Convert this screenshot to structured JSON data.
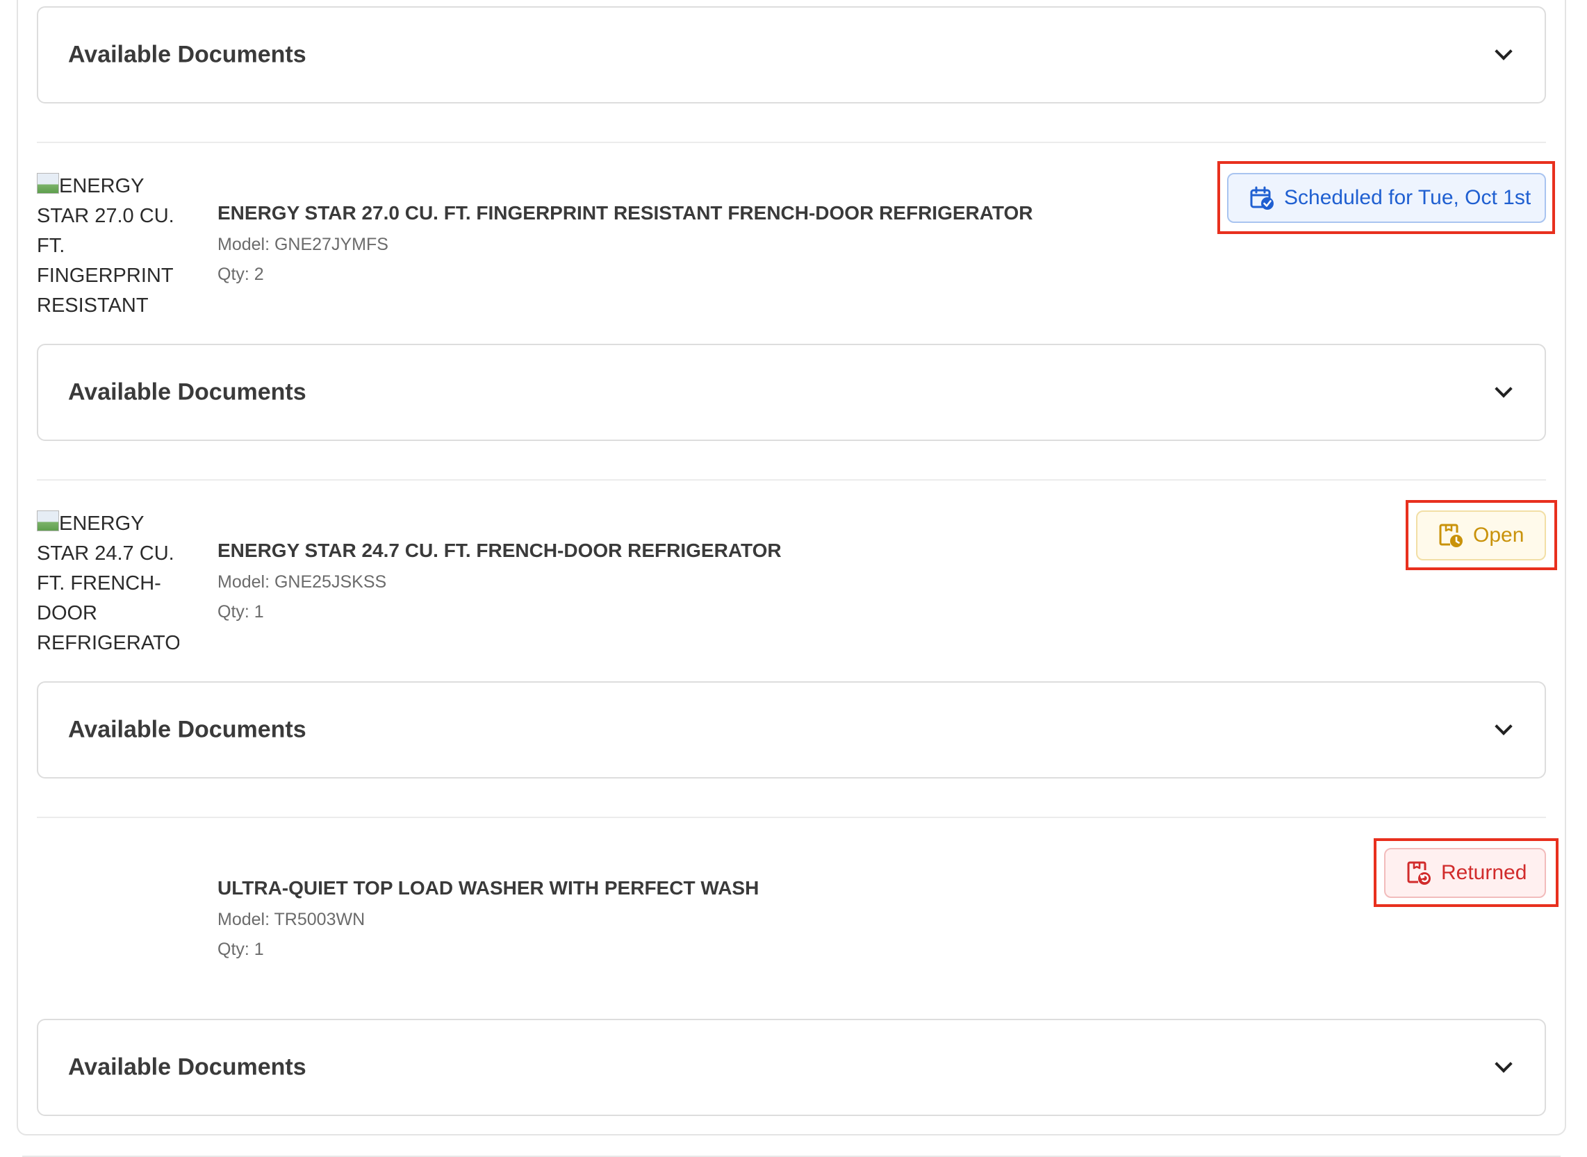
{
  "documents_label": "Available Documents",
  "items": [
    {
      "image_alt_lines": [
        "ENERGY",
        "STAR 27.0 CU.",
        "FT.",
        "FINGERPRINT",
        "RESISTANT"
      ],
      "name": "ENERGY STAR 27.0 CU. FT. FINGERPRINT RESISTANT FRENCH-DOOR REFRIGERATOR",
      "model": "Model: GNE27JYMFS",
      "qty": "Qty: 2",
      "status": "Scheduled for Tue, Oct 1st",
      "status_type": "scheduled",
      "status_icon": "calendar-check-icon"
    },
    {
      "image_alt_lines": [
        "ENERGY",
        "STAR 24.7 CU.",
        "FT. FRENCH-",
        "DOOR",
        "REFRIGERATOR"
      ],
      "name": "ENERGY STAR 24.7 CU. FT. FRENCH-DOOR REFRIGERATOR",
      "model": "Model: GNE25JSKSS",
      "qty": "Qty: 1",
      "status": "Open",
      "status_type": "open",
      "status_icon": "package-clock-icon"
    },
    {
      "image_alt_lines": [],
      "name": "ULTRA-QUIET TOP LOAD WASHER WITH PERFECT WASH",
      "model": "Model: TR5003WN",
      "qty": "Qty: 1",
      "status": "Returned",
      "status_type": "returned",
      "status_icon": "package-return-icon"
    }
  ],
  "colors": {
    "scheduled": "#1f5fd1",
    "open": "#c9920a",
    "returned": "#d12b2b",
    "highlight": "#e8301e"
  }
}
